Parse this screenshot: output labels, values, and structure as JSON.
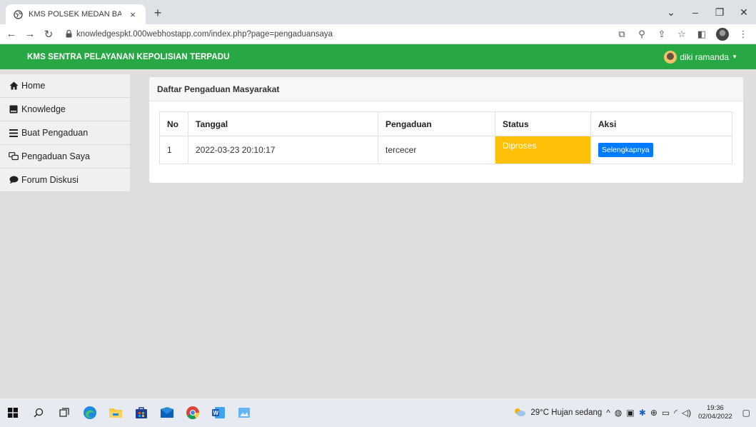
{
  "browser": {
    "tab_title": "KMS POLSEK MEDAN BARAT",
    "tab_close": "×",
    "new_tab": "+",
    "url": "knowledgespkt.000webhostapp.com/index.php?page=pengaduansaya"
  },
  "navbar": {
    "brand": "KMS SENTRA PELAYANAN KEPOLISIAN TERPADU",
    "user": "diki ramanda"
  },
  "sidebar": {
    "items": [
      {
        "label": "Home",
        "icon": "home-icon"
      },
      {
        "label": "Knowledge",
        "icon": "book-icon"
      },
      {
        "label": "Buat Pengaduan",
        "icon": "list-icon"
      },
      {
        "label": "Pengaduan Saya",
        "icon": "chat-icon"
      },
      {
        "label": "Forum Diskusi",
        "icon": "comment-icon"
      }
    ]
  },
  "main": {
    "title": "Daftar Pengaduan Masyarakat",
    "table": {
      "headers": [
        "No",
        "Tanggal",
        "Pengaduan",
        "Status",
        "Aksi"
      ],
      "rows": [
        {
          "no": "1",
          "tanggal": "2022-03-23 20:10:17",
          "pengaduan": "tercecer",
          "status": "Diproses",
          "aksi": "Selengkapnya"
        }
      ]
    }
  },
  "taskbar": {
    "weather": "29°C  Hujan sedang",
    "time": "19:36",
    "date": "02/04/2022"
  },
  "colors": {
    "navbar": "#28a745",
    "status_diproses": "#ffc107",
    "button": "#007bff"
  }
}
